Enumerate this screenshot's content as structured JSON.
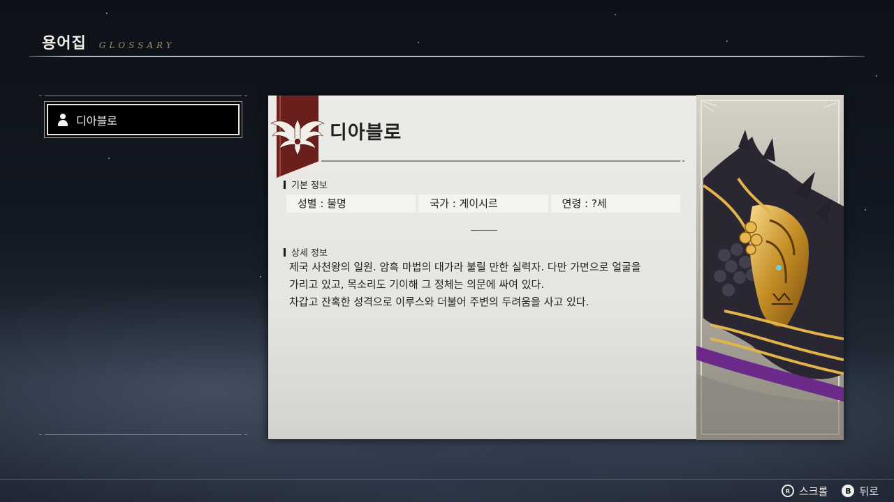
{
  "header": {
    "title": "용어집",
    "subtitle": "GLOSSARY"
  },
  "glossary_list": {
    "items": [
      {
        "label": "디아블로",
        "icon": "person-icon",
        "selected": true
      }
    ]
  },
  "entry": {
    "title": "디아블로",
    "basic_info_heading": "기본 정보",
    "basic_info": [
      "성별 : 불명",
      "국가 : 게이시르",
      "연령 : ?세"
    ],
    "detail_heading": "상세 정보",
    "description_lines": [
      "제국 사천왕의 일원. 암흑 마법의 대가라 불릴 만한 실력자. 다만 가면으로 얼굴을",
      "가리고 있고, 목소리도 기이해 그 정체는 의문에 싸여 있다.",
      "차갑고 잔혹한 성격으로 이루스와 더불어 주변의 두려움을 사고 있다."
    ]
  },
  "footer": {
    "scroll": {
      "icon": "R",
      "label": "스크롤"
    },
    "back": {
      "icon": "B",
      "label": "뒤로"
    }
  },
  "colors": {
    "banner": "#6b1f1c",
    "paper": "#e8e7e3",
    "gold": "#d4a63a"
  }
}
